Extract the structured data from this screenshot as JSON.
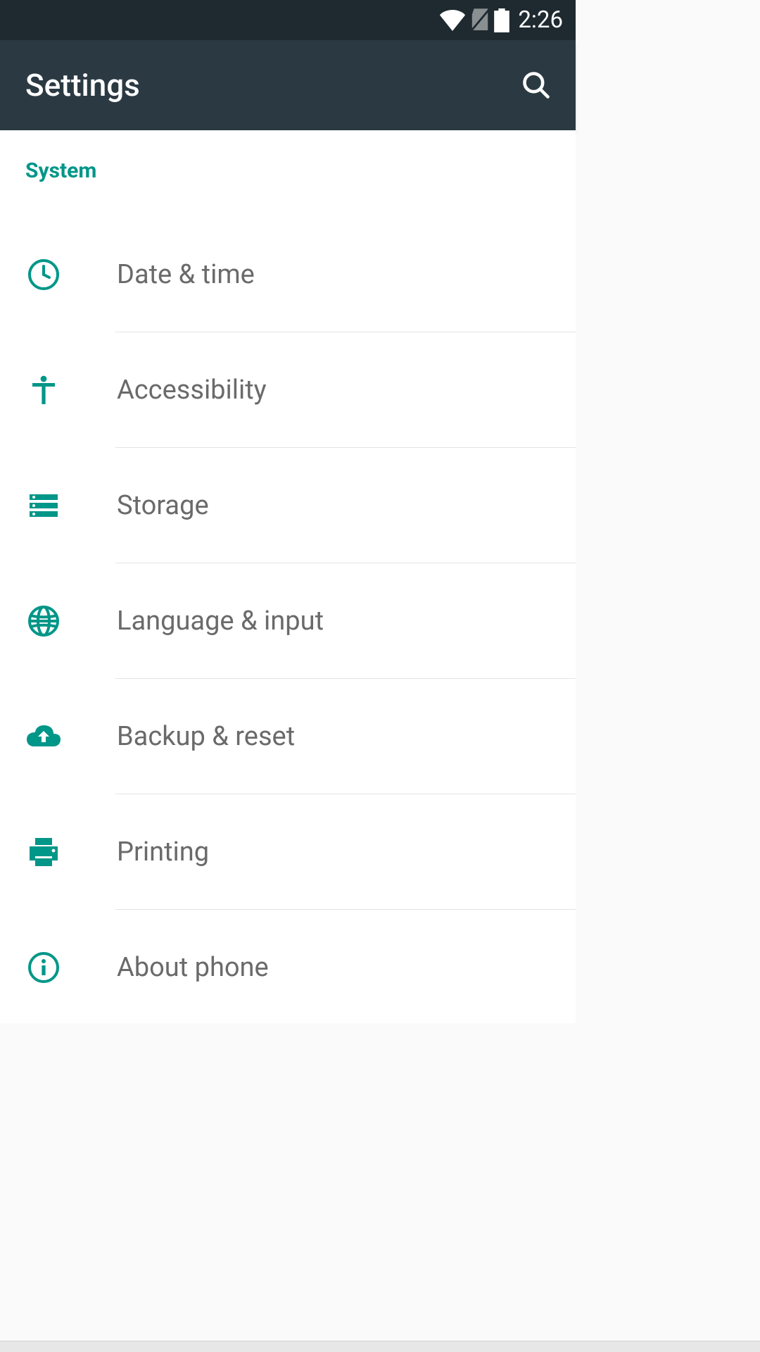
{
  "statusBar": {
    "time": "2:26"
  },
  "appBar": {
    "title": "Settings"
  },
  "section": {
    "header": "System"
  },
  "items": [
    {
      "key": "date-time",
      "label": "Date & time"
    },
    {
      "key": "accessibility",
      "label": "Accessibility"
    },
    {
      "key": "storage",
      "label": "Storage"
    },
    {
      "key": "language-input",
      "label": "Language & input"
    },
    {
      "key": "backup-reset",
      "label": "Backup & reset"
    },
    {
      "key": "printing",
      "label": "Printing"
    },
    {
      "key": "about-phone",
      "label": "About phone"
    }
  ],
  "colors": {
    "accent": "#009688",
    "statusBarBg": "#1e2a30",
    "appBarBg": "#2b3a42"
  }
}
